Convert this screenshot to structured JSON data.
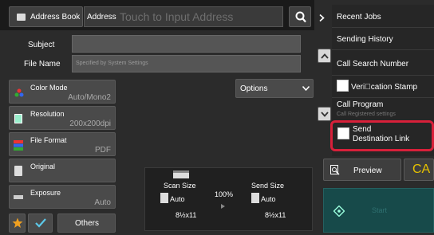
{
  "header": {
    "address_book_label": "Address Book",
    "address_label": "Address",
    "address_placeholder": "Touch to Input Address"
  },
  "fields": {
    "subject_label": "Subject",
    "file_name_label": "File Name",
    "file_name_placeholder": "Specified by System Settings",
    "options_label": "Options"
  },
  "settings": [
    {
      "label": "Color Mode",
      "value": "Auto/Mono2"
    },
    {
      "label": "Resolution",
      "value": "200x200dpi"
    },
    {
      "label": "File Format",
      "value": "PDF"
    },
    {
      "label": "Original",
      "value": ""
    },
    {
      "label": "Exposure",
      "value": "Auto"
    }
  ],
  "bottom": {
    "others_label": "Others"
  },
  "preview_panel": {
    "scan_size_label": "Scan Size",
    "scan_size_value": "Auto",
    "scan_paper": "8½x11",
    "ratio": "100%",
    "send_size_label": "Send Size",
    "send_size_value": "Auto",
    "send_paper": "8½x11"
  },
  "right_menu": {
    "recent_jobs": "Recent Jobs",
    "sending_history": "Sending History",
    "call_search_number": "Call Search Number",
    "verification_stamp": "Veri\u0000cation Stamp",
    "call_program": "Call Program",
    "call_registered": "Call Registered settings",
    "send_destination_link": "Send\nDestination Link"
  },
  "actions": {
    "preview_label": "Preview",
    "ca_label": "CA",
    "start_label": "Start"
  },
  "colors": {
    "highlight": "#d8203a",
    "teal": "#1a5a5a",
    "ca_yellow": "#e6c200"
  }
}
